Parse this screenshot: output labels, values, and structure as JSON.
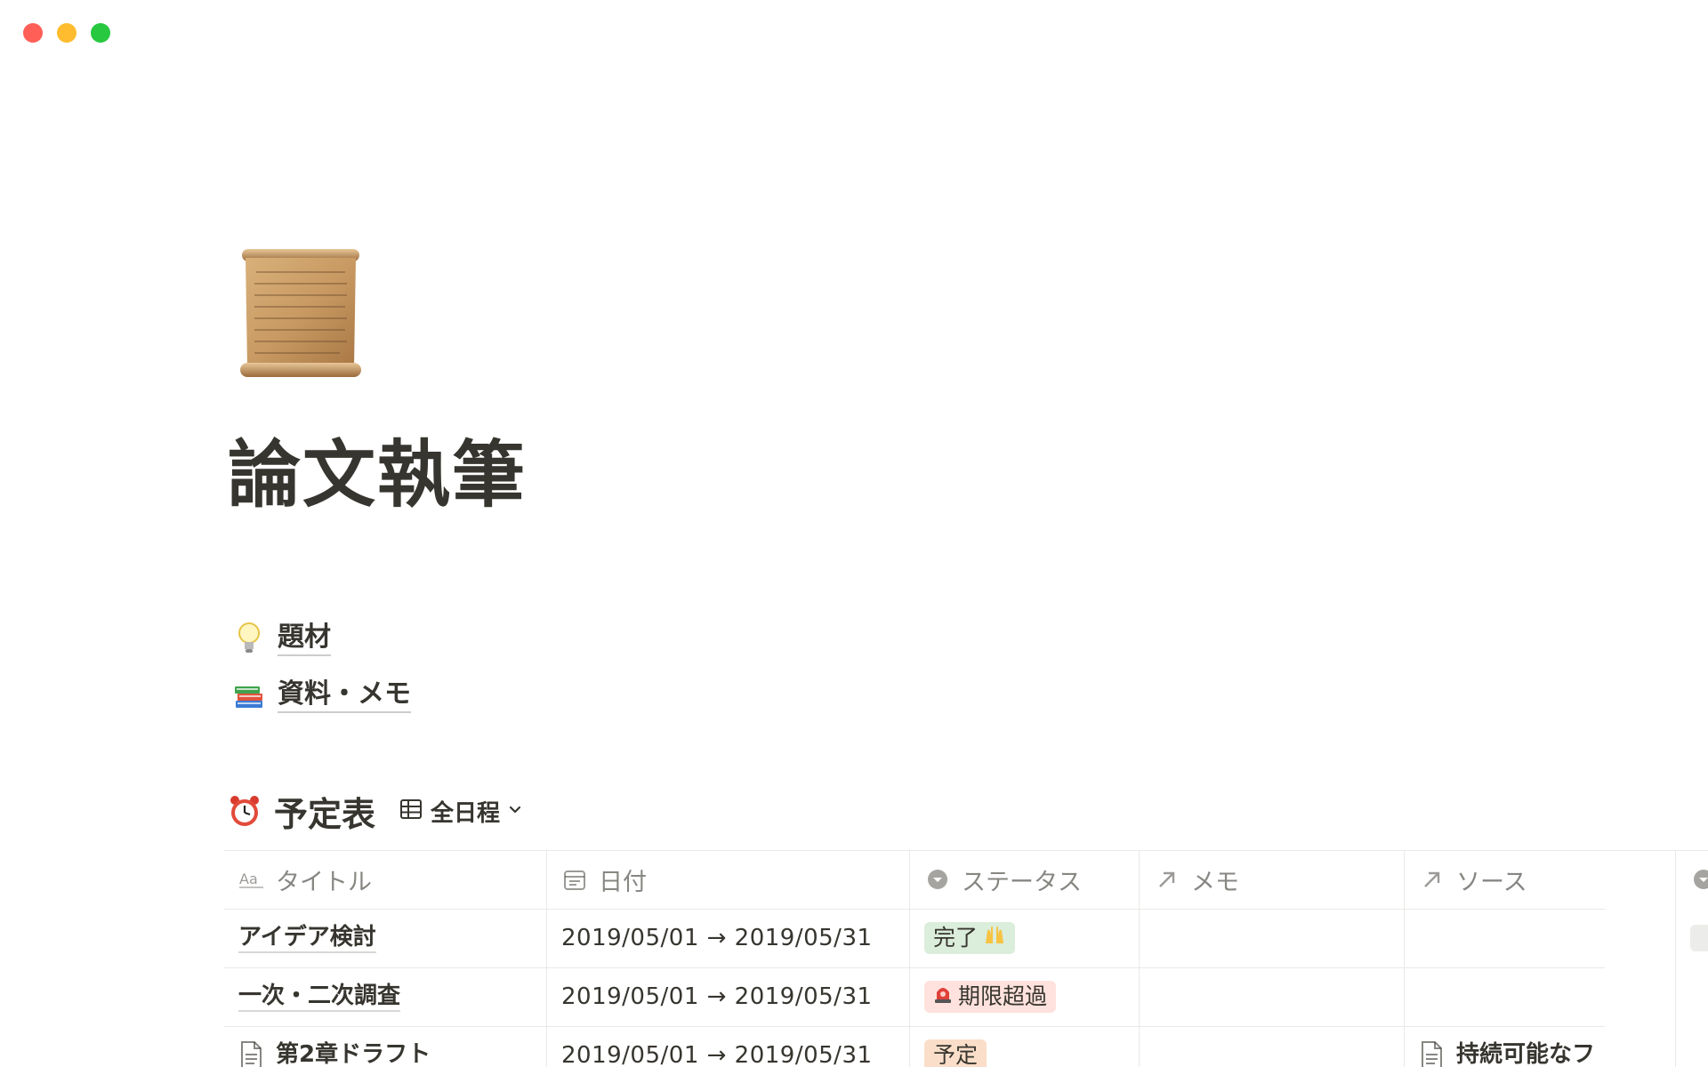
{
  "window": {
    "controls": [
      "close",
      "minimize",
      "zoom"
    ]
  },
  "page": {
    "icon": "scroll-icon",
    "title": "論文執筆"
  },
  "links": [
    {
      "icon": "lightbulb-icon",
      "label": "題材"
    },
    {
      "icon": "books-icon",
      "label": "資料・メモ"
    }
  ],
  "database": {
    "icon": "alarm-clock-icon",
    "title": "予定表",
    "view_icon": "table-view-icon",
    "view_label": "全日程",
    "columns": [
      {
        "icon": "text-property-icon",
        "label": "タイトル"
      },
      {
        "icon": "calendar-icon",
        "label": "日付"
      },
      {
        "icon": "select-property-icon",
        "label": "ステータス"
      },
      {
        "icon": "relation-arrow-icon",
        "label": "メモ"
      },
      {
        "icon": "relation-arrow-icon",
        "label": "ソース"
      }
    ],
    "rows": [
      {
        "title": "アイデア検討",
        "date": "2019/05/01 → 2019/05/31",
        "status": {
          "label": "完了",
          "emoji": "🙌",
          "bg": "#dbeddb"
        },
        "memo": "",
        "source": ""
      },
      {
        "title": "一次・二次調査",
        "date": "2019/05/01 → 2019/05/31",
        "status": {
          "label": "期限超過",
          "emoji": "🚨",
          "bg": "#ffe2dd"
        },
        "memo": "",
        "source": ""
      },
      {
        "title": "第2章ドラフト",
        "date": "2019/05/01 → 2019/05/31",
        "status": {
          "label": "予定",
          "emoji": "",
          "bg": "#fadec9"
        },
        "memo": "",
        "source": "持続可能なフ"
      }
    ]
  },
  "colors": {
    "text": "#37352f",
    "muted": "rgba(55,53,47,0.6)",
    "border": "#e9e9e7"
  }
}
